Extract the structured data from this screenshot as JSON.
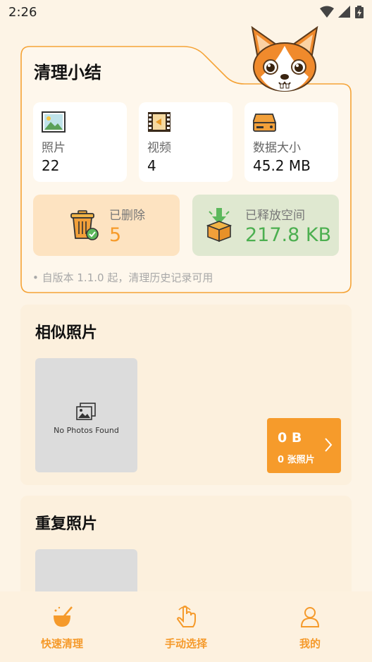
{
  "status_bar": {
    "time": "2:26"
  },
  "summary": {
    "title": "清理小结",
    "stats": [
      {
        "icon": "photo-icon",
        "label": "照片",
        "value": "22"
      },
      {
        "icon": "video-icon",
        "label": "视频",
        "value": "4"
      },
      {
        "icon": "storage-icon",
        "label": "数据大小",
        "value": "45.2 MB"
      }
    ],
    "deleted": {
      "icon": "trash-icon",
      "label": "已删除",
      "value": "5"
    },
    "freed": {
      "icon": "box-icon",
      "label": "已释放空间",
      "value": "217.8 KB"
    },
    "note": "• 自版本 1.1.0 起，清理历史记录可用"
  },
  "similar_photos": {
    "title": "相似照片",
    "empty_text": "No Photos Found",
    "size": "0 B",
    "count": "0 张照片"
  },
  "duplicate_photos": {
    "title": "重复照片"
  },
  "bottom_nav": [
    {
      "icon": "broom-icon",
      "label": "快速清理"
    },
    {
      "icon": "hand-tap-icon",
      "label": "手动选择"
    },
    {
      "icon": "user-icon",
      "label": "我的"
    }
  ],
  "colors": {
    "accent": "#f69b2b",
    "deleted_bg": "#fde3c1",
    "freed_bg": "#dfe8d0",
    "freed_value": "#4caf50",
    "background": "#fdf4e6"
  }
}
